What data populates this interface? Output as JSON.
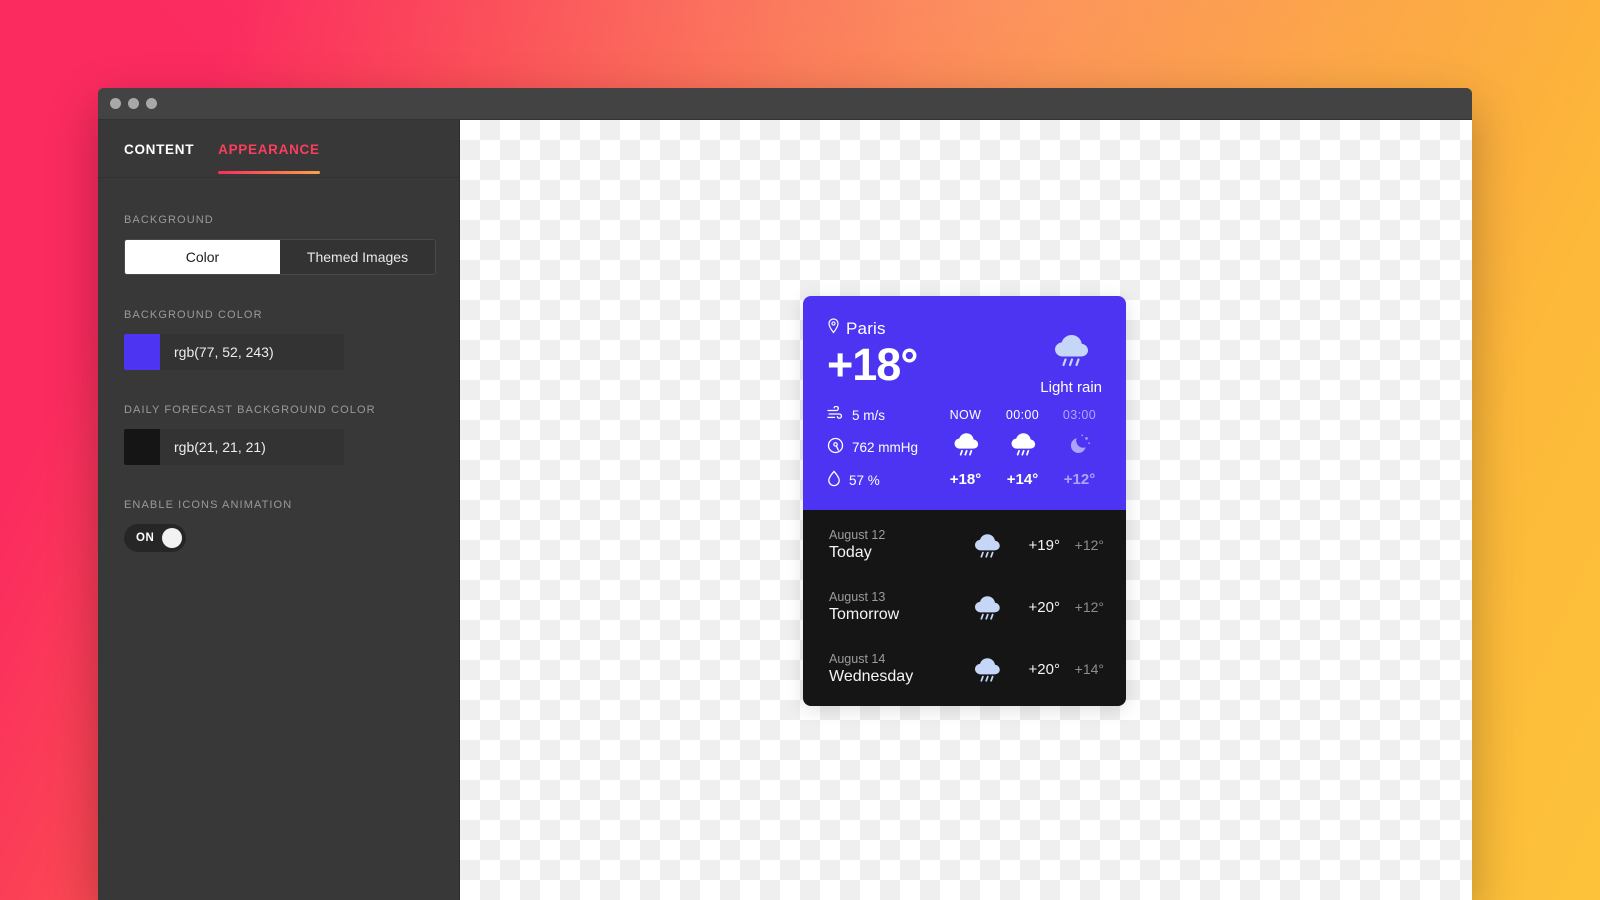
{
  "window": {
    "traffic_lights": [
      "close",
      "minimize",
      "maximize"
    ]
  },
  "sidebar": {
    "tabs": [
      {
        "label": "CONTENT",
        "active": false
      },
      {
        "label": "APPEARANCE",
        "active": true
      }
    ],
    "groups": {
      "background": {
        "label": "BACKGROUND",
        "options": [
          "Color",
          "Themed Images"
        ],
        "selected": "Color"
      },
      "background_color": {
        "label": "BACKGROUND COLOR",
        "value": "rgb(77, 52, 243)",
        "swatch_hex": "#4d34f3"
      },
      "daily_forecast_background_color": {
        "label": "DAILY FORECAST BACKGROUND COLOR",
        "value": "rgb(21, 21, 21)",
        "swatch_hex": "#151515"
      },
      "enable_icons_animation": {
        "label": "ENABLE ICONS ANIMATION",
        "state": "ON"
      }
    }
  },
  "widget": {
    "current": {
      "city": "Paris",
      "temperature": "+18°",
      "condition": "Light rain",
      "condition_icon": "rain-cloud-icon",
      "location_icon": "map-pin-icon"
    },
    "metrics": [
      {
        "icon": "wind-icon",
        "value": "5 m/s"
      },
      {
        "icon": "barometer-icon",
        "value": "762 mmHg"
      },
      {
        "icon": "humidity-icon",
        "value": "57 %"
      }
    ],
    "hourly": [
      {
        "time": "NOW",
        "icon": "rain-cloud-icon",
        "temp": "+18°",
        "faded": false
      },
      {
        "time": "00:00",
        "icon": "rain-cloud-icon",
        "temp": "+14°",
        "faded": false
      },
      {
        "time": "03:00",
        "icon": "moon-stars-icon",
        "temp": "+12°",
        "faded": true
      }
    ],
    "hourly_next_icon": "chevron-right-icon",
    "daily": [
      {
        "date": "August 12",
        "name": "Today",
        "icon": "rain-cloud-icon",
        "high": "+19°",
        "low": "+12°"
      },
      {
        "date": "August 13",
        "name": "Tomorrow",
        "icon": "rain-cloud-icon",
        "high": "+20°",
        "low": "+12°"
      },
      {
        "date": "August 14",
        "name": "Wednesday",
        "icon": "rain-cloud-icon",
        "high": "+20°",
        "low": "+14°"
      }
    ]
  },
  "theme": {
    "widget_bg": "#4d34f3",
    "daily_bg": "#151515",
    "accent_start": "#fb2b5f",
    "accent_end": "#fdc23a",
    "sidebar_bg": "#383838",
    "titlebar_bg": "#434343"
  }
}
